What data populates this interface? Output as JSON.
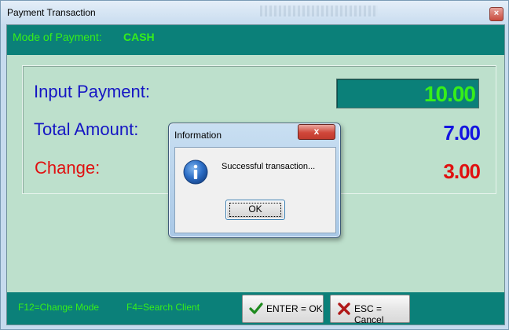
{
  "window": {
    "title": "Payment Transaction",
    "close_glyph": "×"
  },
  "mode_bar": {
    "label": "Mode of Payment:",
    "value": "CASH"
  },
  "payment": {
    "input_label": "Input Payment:",
    "input_value": "10.00",
    "total_label": "Total Amount:",
    "total_value": "7.00",
    "change_label": "Change:",
    "change_value": "3.00"
  },
  "footer": {
    "hint_change_mode": "F12=Change Mode",
    "hint_search_client": "F4=Search Client",
    "enter_label": "ENTER = OK",
    "enter_icon": "checkmark-icon",
    "esc_label": "ESC = Cancel",
    "esc_icon": "x-icon"
  },
  "dialog": {
    "title": "Information",
    "close_glyph": "x",
    "icon": "info-icon",
    "message": "Successful transaction...",
    "ok_label": "OK"
  },
  "colors": {
    "teal_bar": "#0b8079",
    "panel_bg": "#bde0cc",
    "green_text": "#36ef1a",
    "blue_text": "#1515c4",
    "red_text": "#e01010"
  }
}
